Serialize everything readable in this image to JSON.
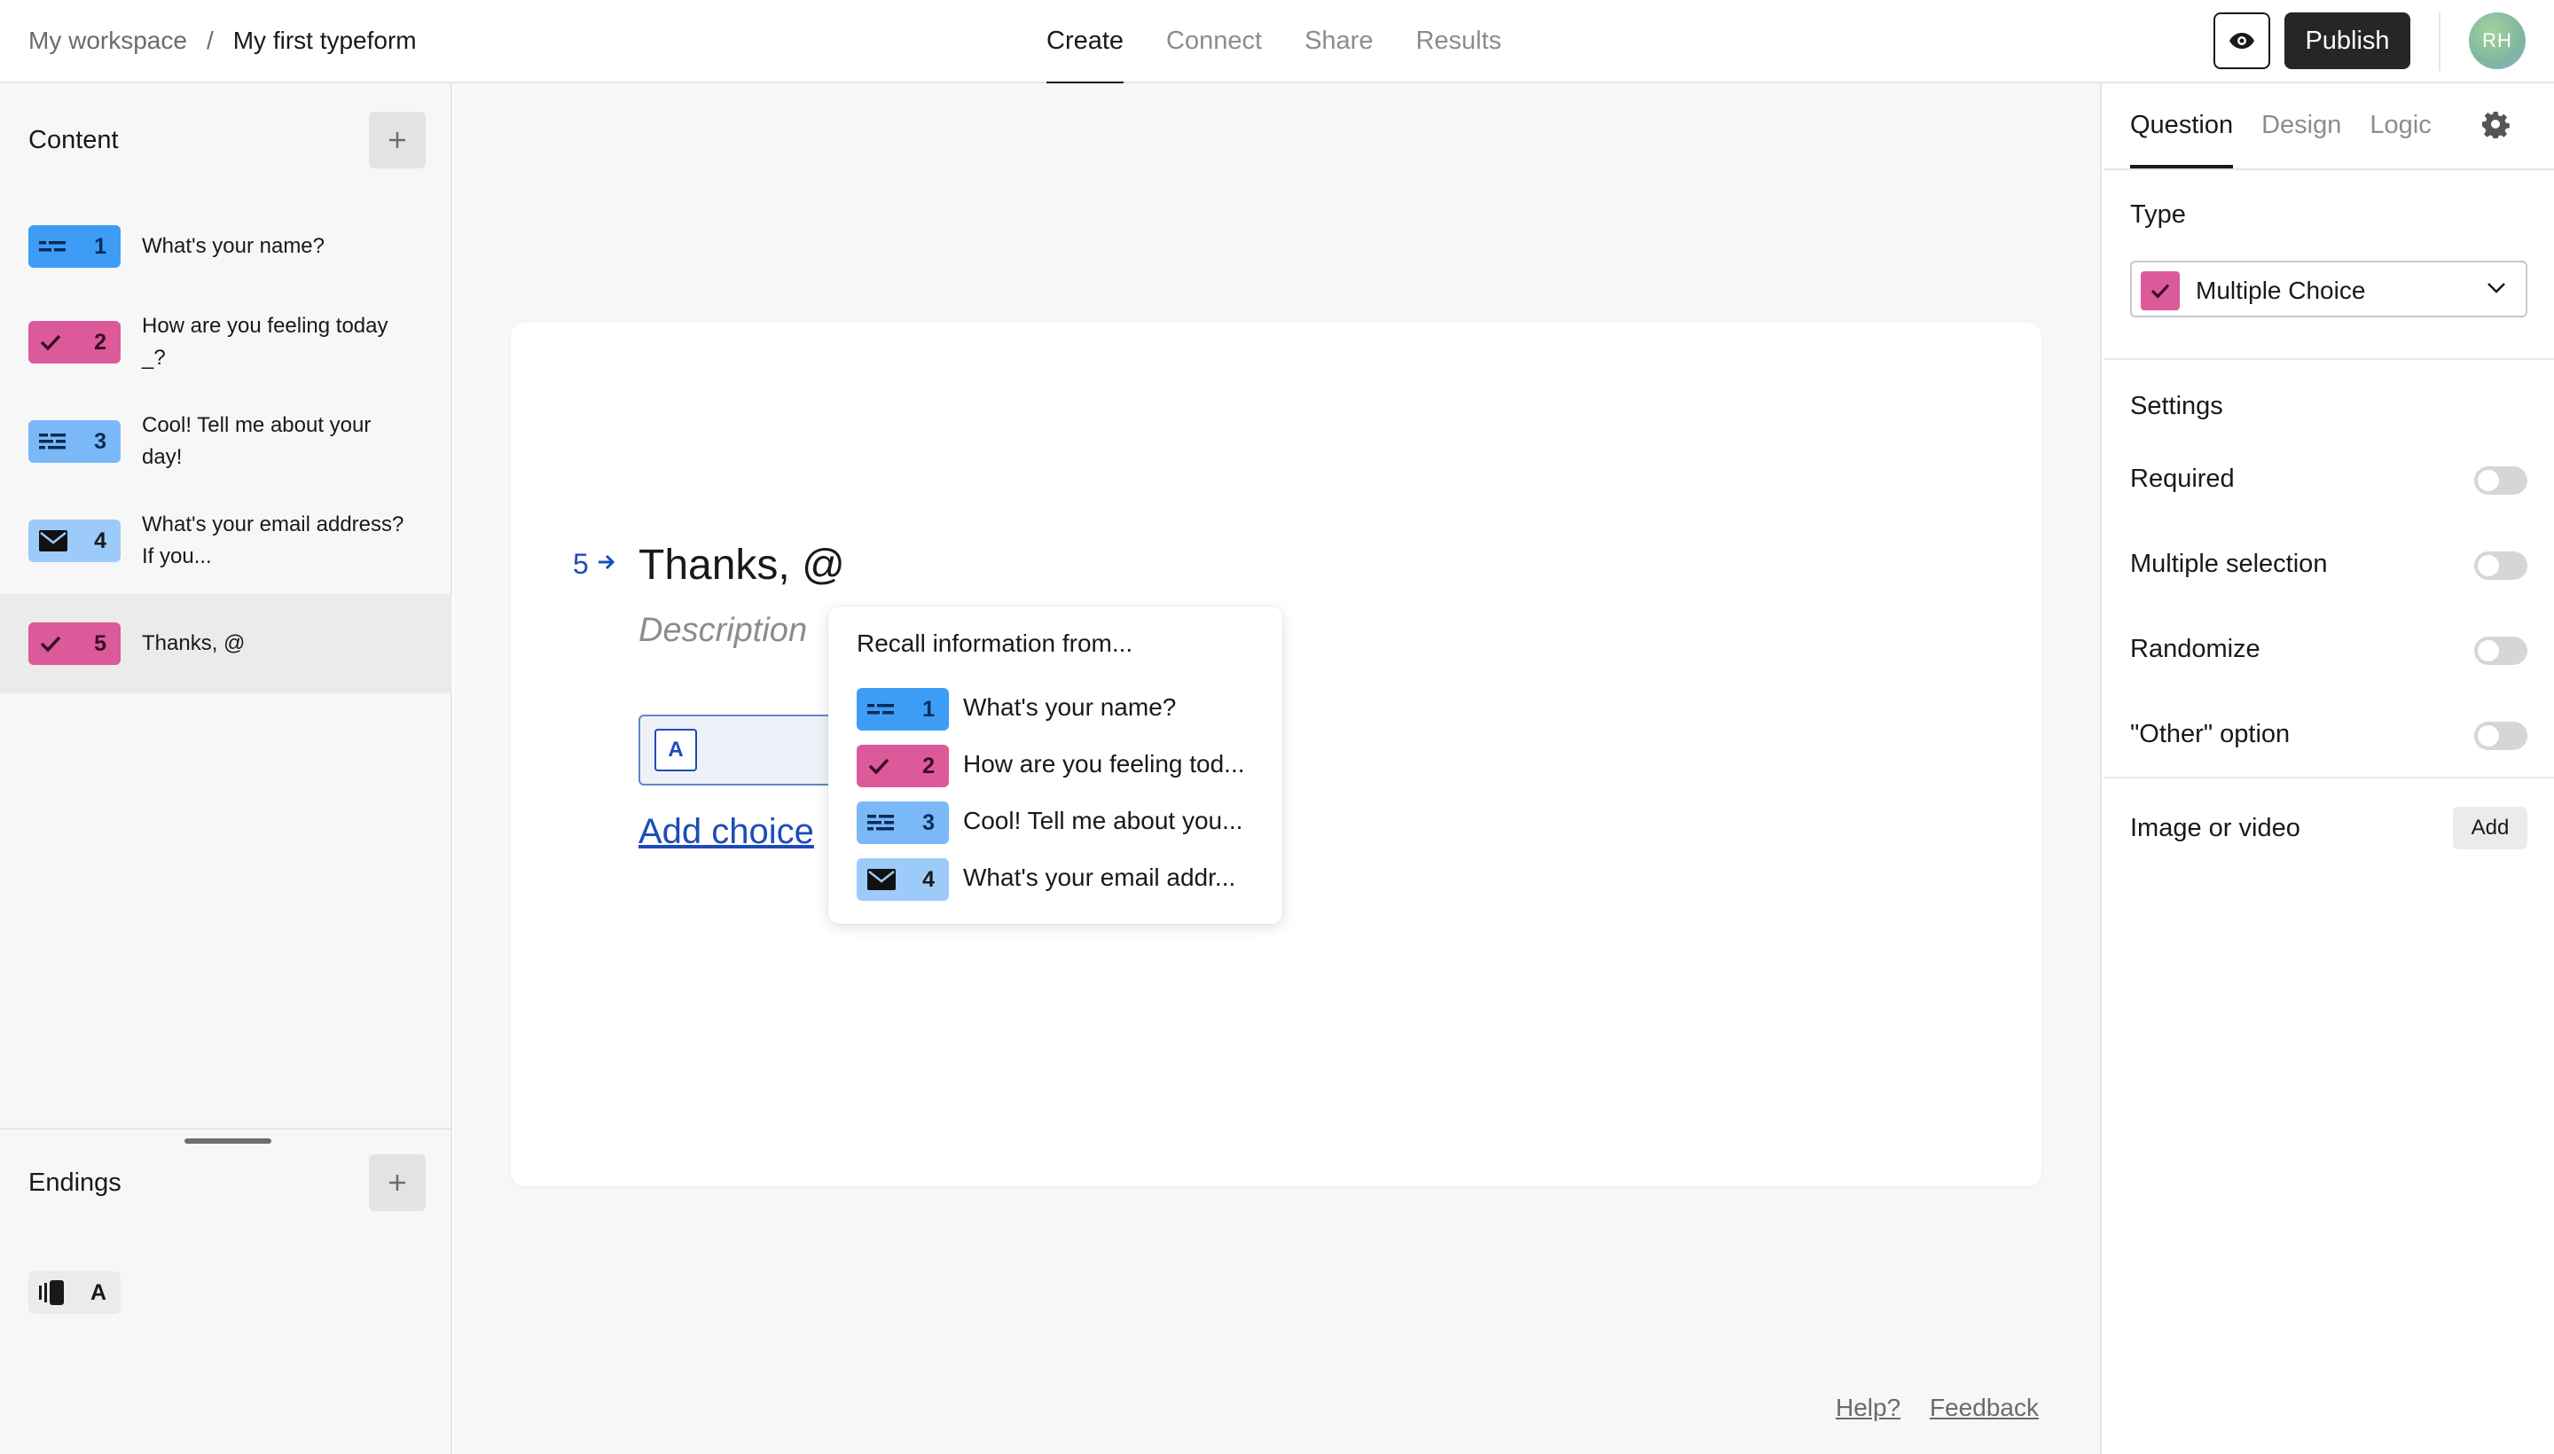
{
  "header": {
    "breadcrumb_workspace": "My workspace",
    "breadcrumb_separator": "/",
    "breadcrumb_form": "My first typeform",
    "tabs": [
      {
        "label": "Create",
        "active": true
      },
      {
        "label": "Connect",
        "active": false
      },
      {
        "label": "Share",
        "active": false
      },
      {
        "label": "Results",
        "active": false
      }
    ],
    "preview_icon": "eye-icon",
    "publish_label": "Publish",
    "avatar_initials": "RH"
  },
  "sidebar": {
    "content_title": "Content",
    "add_icon": "plus-icon",
    "questions": [
      {
        "number": "1",
        "text": "What's your name?",
        "icon": "short-text-icon",
        "color": "#3d9cf5"
      },
      {
        "number": "2",
        "text": "How are you feeling today _?",
        "icon": "checkmark-icon",
        "color": "#dc5a9a"
      },
      {
        "number": "3",
        "text": "Cool! Tell me about your day!",
        "icon": "long-text-icon",
        "color": "#7ab8f7"
      },
      {
        "number": "4",
        "text": "What's your email address? If you...",
        "icon": "mail-icon",
        "color": "#9ccbfa"
      },
      {
        "number": "5",
        "text": "Thanks, @",
        "icon": "checkmark-icon",
        "color": "#dc5a9a",
        "selected": true
      }
    ],
    "endings_title": "Endings",
    "ending": {
      "label": "A",
      "icon": "ending-icon"
    }
  },
  "canvas": {
    "question_number": "5",
    "question_title": "Thanks, @",
    "description_placeholder": "Description",
    "choice_key": "A",
    "add_choice_label": "Add choice",
    "recall": {
      "title": "Recall information from...",
      "items": [
        {
          "number": "1",
          "text": "What's your name?",
          "icon": "short-text-icon"
        },
        {
          "number": "2",
          "text": "How are you feeling tod...",
          "icon": "checkmark-icon"
        },
        {
          "number": "3",
          "text": "Cool! Tell me about you...",
          "icon": "long-text-icon"
        },
        {
          "number": "4",
          "text": "What's your email addr...",
          "icon": "mail-icon"
        }
      ]
    },
    "help_label": "Help?",
    "feedback_label": "Feedback"
  },
  "panel": {
    "tabs": [
      {
        "label": "Question",
        "active": true
      },
      {
        "label": "Design",
        "active": false
      },
      {
        "label": "Logic",
        "active": false
      }
    ],
    "settings_icon": "gear-icon",
    "type_label": "Type",
    "type_value": "Multiple Choice",
    "settings_label": "Settings",
    "toggles": [
      {
        "label": "Required",
        "on": false
      },
      {
        "label": "Multiple selection",
        "on": false
      },
      {
        "label": "Randomize",
        "on": false
      },
      {
        "label": "\"Other\" option",
        "on": false
      }
    ],
    "media_label": "Image or video",
    "media_add_label": "Add"
  },
  "colors": {
    "accent_blue": "#1b4cb8",
    "multiple_choice_pink": "#dc5a9a",
    "short_text_blue": "#3d9cf5",
    "publish_dark": "#262627"
  }
}
